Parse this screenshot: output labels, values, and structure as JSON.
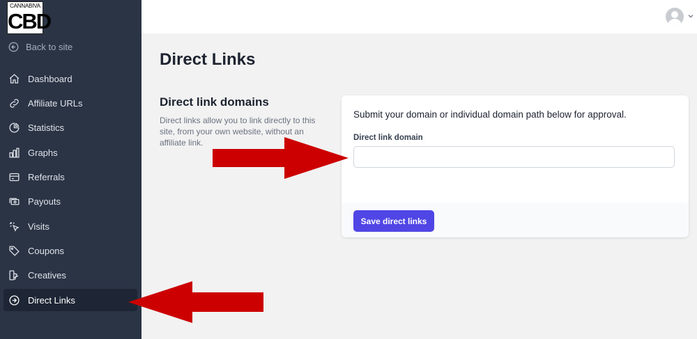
{
  "logo": {
    "top": "CANNABIVA",
    "big": "CBD"
  },
  "sidebar": {
    "back_label": "Back to site",
    "items": [
      {
        "label": "Dashboard",
        "icon": "home-icon"
      },
      {
        "label": "Affiliate URLs",
        "icon": "link-icon"
      },
      {
        "label": "Statistics",
        "icon": "pie-chart-icon"
      },
      {
        "label": "Graphs",
        "icon": "bar-chart-icon"
      },
      {
        "label": "Referrals",
        "icon": "credit-card-icon"
      },
      {
        "label": "Payouts",
        "icon": "cash-icon"
      },
      {
        "label": "Visits",
        "icon": "cursor-click-icon"
      },
      {
        "label": "Coupons",
        "icon": "tag-icon"
      },
      {
        "label": "Creatives",
        "icon": "shapes-icon"
      },
      {
        "label": "Direct Links",
        "icon": "arrow-circle-right-icon",
        "active": true
      }
    ]
  },
  "main": {
    "title": "Direct Links",
    "section_title": "Direct link domains",
    "section_desc": "Direct links allow you to link directly to this site, from your own website, without an affiliate link.",
    "card_text": "Submit your domain or individual domain path below for approval.",
    "field_label": "Direct link domain",
    "field_value": "",
    "save_label": "Save direct links"
  },
  "colors": {
    "sidebar": "#2b3445",
    "accent": "#5046e5",
    "arrow": "#cc0000"
  }
}
